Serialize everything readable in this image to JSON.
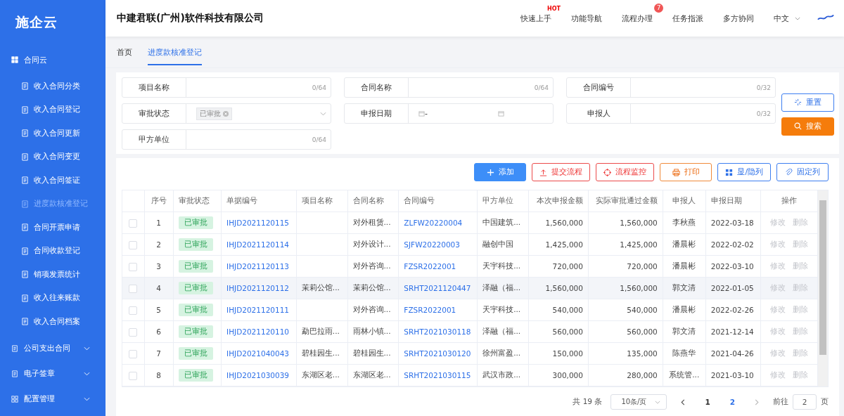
{
  "sidebar": {
    "logo": "施企云",
    "groups": [
      {
        "label": "合同云",
        "expanded": true,
        "children": [
          {
            "label": "收入合同分类",
            "selected": false
          },
          {
            "label": "收入合同登记",
            "selected": false
          },
          {
            "label": "收入合同更新",
            "selected": false
          },
          {
            "label": "收入合同变更",
            "selected": false
          },
          {
            "label": "收入合同签证",
            "selected": false
          },
          {
            "label": "进度款核准登记",
            "selected": true
          },
          {
            "label": "合同开票申请",
            "selected": false
          },
          {
            "label": "合同收款登记",
            "selected": false
          },
          {
            "label": "销项发票统计",
            "selected": false
          },
          {
            "label": "收入往来账款",
            "selected": false
          },
          {
            "label": "收入合同档案",
            "selected": false
          }
        ]
      },
      {
        "label": "公司支出合同",
        "expanded": false
      },
      {
        "label": "电子签章",
        "expanded": false
      },
      {
        "label": "配置管理",
        "expanded": false
      }
    ]
  },
  "header": {
    "company": "中建君联(广州)软件科技有限公司",
    "nav": [
      {
        "label": "快速上手",
        "badge": {
          "text": "HOT",
          "kind": "hot"
        }
      },
      {
        "label": "功能导航"
      },
      {
        "label": "流程办理",
        "badge": {
          "text": "7",
          "kind": "count"
        }
      },
      {
        "label": "任务指派"
      },
      {
        "label": "多方协同"
      }
    ],
    "language": "中文"
  },
  "tabs": [
    {
      "label": "首页",
      "selected": false
    },
    {
      "label": "进度款核准登记",
      "selected": true
    }
  ],
  "filters": [
    {
      "label": "项目名称",
      "kind": "text",
      "counter": "0/64"
    },
    {
      "label": "合同名称",
      "kind": "text",
      "counter": "0/64"
    },
    {
      "label": "合同编号",
      "kind": "text",
      "counter": "0/32"
    },
    {
      "label": "审批状态",
      "kind": "select",
      "tag": "已审批"
    },
    {
      "label": "申报日期",
      "kind": "daterange",
      "separator": "-"
    },
    {
      "label": "申报人",
      "kind": "text",
      "counter": "0/32"
    },
    {
      "label": "甲方单位",
      "kind": "text",
      "counter": "0/64"
    }
  ],
  "filter_buttons": [
    {
      "label": "重置",
      "kind": "outline"
    },
    {
      "label": "搜索",
      "kind": "orange"
    }
  ],
  "toolbar": [
    {
      "label": "添加",
      "kind": "primary"
    },
    {
      "label": "提交流程",
      "kind": "danger"
    },
    {
      "label": "流程监控",
      "kind": "danger"
    },
    {
      "label": "打印",
      "kind": "warning"
    },
    {
      "label": "显/隐列",
      "kind": "outline"
    },
    {
      "label": "固定列",
      "kind": "outline"
    }
  ],
  "table": {
    "columns": [
      "序号",
      "审批状态",
      "单据编号",
      "项目名称",
      "合同名称",
      "合同编号",
      "甲方单位",
      "本次申报金额",
      "实际审批通过金额",
      "申报人",
      "申报日期",
      "操作"
    ],
    "rows": [
      {
        "checked": false,
        "highlighted": false,
        "no": "1",
        "status": "已审批",
        "doc_no": "IHJD2021120115",
        "project": "",
        "contract_name": "对外租赁...",
        "contract_no": "ZLFW20220004",
        "party_a": "中国建筑...",
        "amount": "1,560,000",
        "approved": "1,560,000",
        "reporter": "李秋燕",
        "date": "2022-03-18",
        "actions": [
          {
            "label": "修改",
            "disabled": true
          },
          {
            "label": "删除",
            "disabled": true
          }
        ]
      },
      {
        "checked": false,
        "highlighted": false,
        "no": "2",
        "status": "已审批",
        "doc_no": "IHJD2021120114",
        "project": "",
        "contract_name": "对外设计...",
        "contract_no": "SJFW20220003",
        "party_a": "融创中国",
        "amount": "1,425,000",
        "approved": "1,425,000",
        "reporter": "潘晨彬",
        "date": "2022-02-02",
        "actions": [
          {
            "label": "修改",
            "disabled": true
          },
          {
            "label": "删除",
            "disabled": true
          }
        ]
      },
      {
        "checked": false,
        "highlighted": false,
        "no": "3",
        "status": "已审批",
        "doc_no": "IHJD2021120113",
        "project": "",
        "contract_name": "对外咨询...",
        "contract_no": "FZSR2022001",
        "party_a": "天宇科技...",
        "amount": "720,000",
        "approved": "720,000",
        "reporter": "潘晨彬",
        "date": "2022-03-10",
        "actions": [
          {
            "label": "修改",
            "disabled": true
          },
          {
            "label": "删除",
            "disabled": true
          }
        ]
      },
      {
        "checked": false,
        "highlighted": true,
        "no": "4",
        "status": "已审批",
        "doc_no": "IHJD2021120112",
        "project": "茉莉公馆...",
        "contract_name": "茉莉公馆...",
        "contract_no": "SRHT2021120447",
        "party_a": "泽融（福...",
        "amount": "1,560,000",
        "approved": "1,560,000",
        "reporter": "郭文清",
        "date": "2022-01-05",
        "actions": [
          {
            "label": "修改",
            "disabled": true
          },
          {
            "label": "删除",
            "disabled": true
          }
        ]
      },
      {
        "checked": false,
        "highlighted": false,
        "no": "5",
        "status": "已审批",
        "doc_no": "IHJD2021120111",
        "project": "",
        "contract_name": "对外咨询...",
        "contract_no": "FZSR2022001",
        "party_a": "天宇科技...",
        "amount": "540,000",
        "approved": "540,000",
        "reporter": "潘晨彬",
        "date": "2022-02-26",
        "actions": [
          {
            "label": "修改",
            "disabled": true
          },
          {
            "label": "删除",
            "disabled": true
          }
        ]
      },
      {
        "checked": false,
        "highlighted": false,
        "no": "6",
        "status": "已审批",
        "doc_no": "IHJD2021120110",
        "project": "勐巴拉雨...",
        "contract_name": "雨林小镇...",
        "contract_no": "SRHT2021030118",
        "party_a": "泽融（福...",
        "amount": "560,000",
        "approved": "560,000",
        "reporter": "郭文清",
        "date": "2021-12-14",
        "actions": [
          {
            "label": "修改",
            "disabled": true
          },
          {
            "label": "删除",
            "disabled": true
          }
        ]
      },
      {
        "checked": false,
        "highlighted": false,
        "no": "7",
        "status": "已审批",
        "doc_no": "IHJD2021040043",
        "project": "碧桂园生...",
        "contract_name": "碧桂园生...",
        "contract_no": "SRHT2021030120",
        "party_a": "徐州富盈...",
        "amount": "150,000",
        "approved": "135,000",
        "reporter": "陈燕华",
        "date": "2021-04-26",
        "actions": [
          {
            "label": "修改",
            "disabled": true
          },
          {
            "label": "删除",
            "disabled": true
          }
        ]
      },
      {
        "checked": false,
        "highlighted": false,
        "no": "8",
        "status": "已审批",
        "doc_no": "IHJD2021030039",
        "project": "东湖区老...",
        "contract_name": "东湖区老...",
        "contract_no": "SRHT2021030115",
        "party_a": "武汉市政...",
        "amount": "300,000",
        "approved": "280,000",
        "reporter": "系统管...",
        "date": "2021-03-10",
        "actions": [
          {
            "label": "修改",
            "disabled": true
          },
          {
            "label": "删除",
            "disabled": true
          }
        ]
      }
    ]
  },
  "pagination": {
    "total": "共 19 条",
    "page_size": "10条/页",
    "pages": [
      {
        "label": "1",
        "selected": false
      },
      {
        "label": "2",
        "selected": true
      }
    ],
    "goto_label": "前往",
    "goto_value": "2",
    "goto_unit": "页"
  }
}
